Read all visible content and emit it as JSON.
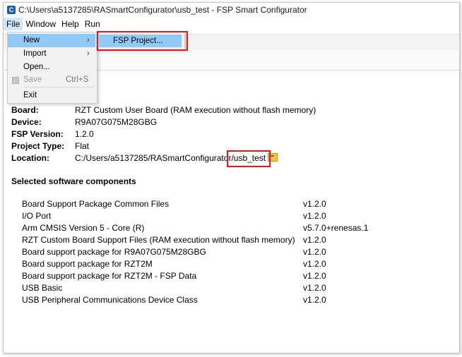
{
  "window": {
    "title": "C:\\Users\\a5137285\\RASmartConfigurator\\usb_test - FSP Smart Configurator",
    "icon": "fsp-app-icon"
  },
  "menubar": {
    "items": [
      "File",
      "Window",
      "Help",
      "Run"
    ]
  },
  "file_menu": {
    "new": "New",
    "import": "Import",
    "open": "Open...",
    "save": "Save",
    "save_shortcut": "Ctrl+S",
    "exit": "Exit"
  },
  "new_submenu": {
    "fsp_project": "FSP Project..."
  },
  "summary": {
    "board_label": "Board:",
    "board": "RZT Custom User Board (RAM execution without flash memory)",
    "device_label": "Device:",
    "device": "R9A07G075M28GBG",
    "fsp_version_label": "FSP Version:",
    "fsp_version": "1.2.0",
    "project_type_label": "Project Type:",
    "project_type": "Flat",
    "location_label": "Location:",
    "location_prefix": "C:/Users/a5137285/RASmartConfigurator/",
    "location_folder": "usb_test"
  },
  "components": {
    "title": "Selected software components",
    "items": [
      {
        "name": "Board Support Package Common Files",
        "version": "v1.2.0"
      },
      {
        "name": "I/O Port",
        "version": "v1.2.0"
      },
      {
        "name": "Arm CMSIS Version 5 - Core (R)",
        "version": "v5.7.0+renesas.1"
      },
      {
        "name": "RZT Custom Board Support Files (RAM execution without flash memory)",
        "version": "v1.2.0"
      },
      {
        "name": "Board support package for R9A07G075M28GBG",
        "version": "v1.2.0"
      },
      {
        "name": "Board support package for RZT2M",
        "version": "v1.2.0"
      },
      {
        "name": "Board support package for RZT2M - FSP Data",
        "version": "v1.2.0"
      },
      {
        "name": "USB Basic",
        "version": "v1.2.0"
      },
      {
        "name": "USB Peripheral Communications Device Class",
        "version": "v1.2.0"
      }
    ]
  },
  "colors": {
    "highlight": "#91c9f7",
    "annotation": "#e8151b",
    "icon_blue": "#1d5fa8"
  }
}
